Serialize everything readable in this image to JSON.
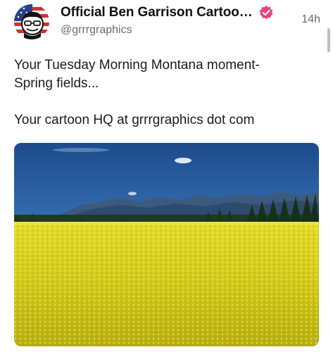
{
  "post": {
    "author": {
      "display_name": "Official  Ben Garrison Cartoo…",
      "handle": "@grrrgraphics",
      "verified_icon": "verified-badge-icon",
      "avatar_icon": "avatar-image"
    },
    "timestamp": "14h",
    "text": {
      "line1": "Your Tuesday Morning Montana moment-",
      "line2": "Spring fields...",
      "line3": "Your cartoon HQ at grrrgraphics dot com"
    },
    "media": {
      "type": "photo",
      "icon": "landscape-photo"
    }
  },
  "colors": {
    "verified_badge": "#e8447a",
    "sky_top": "#1f4f8f",
    "sky_bottom": "#6fa6d6",
    "field": "#d9d21a"
  }
}
